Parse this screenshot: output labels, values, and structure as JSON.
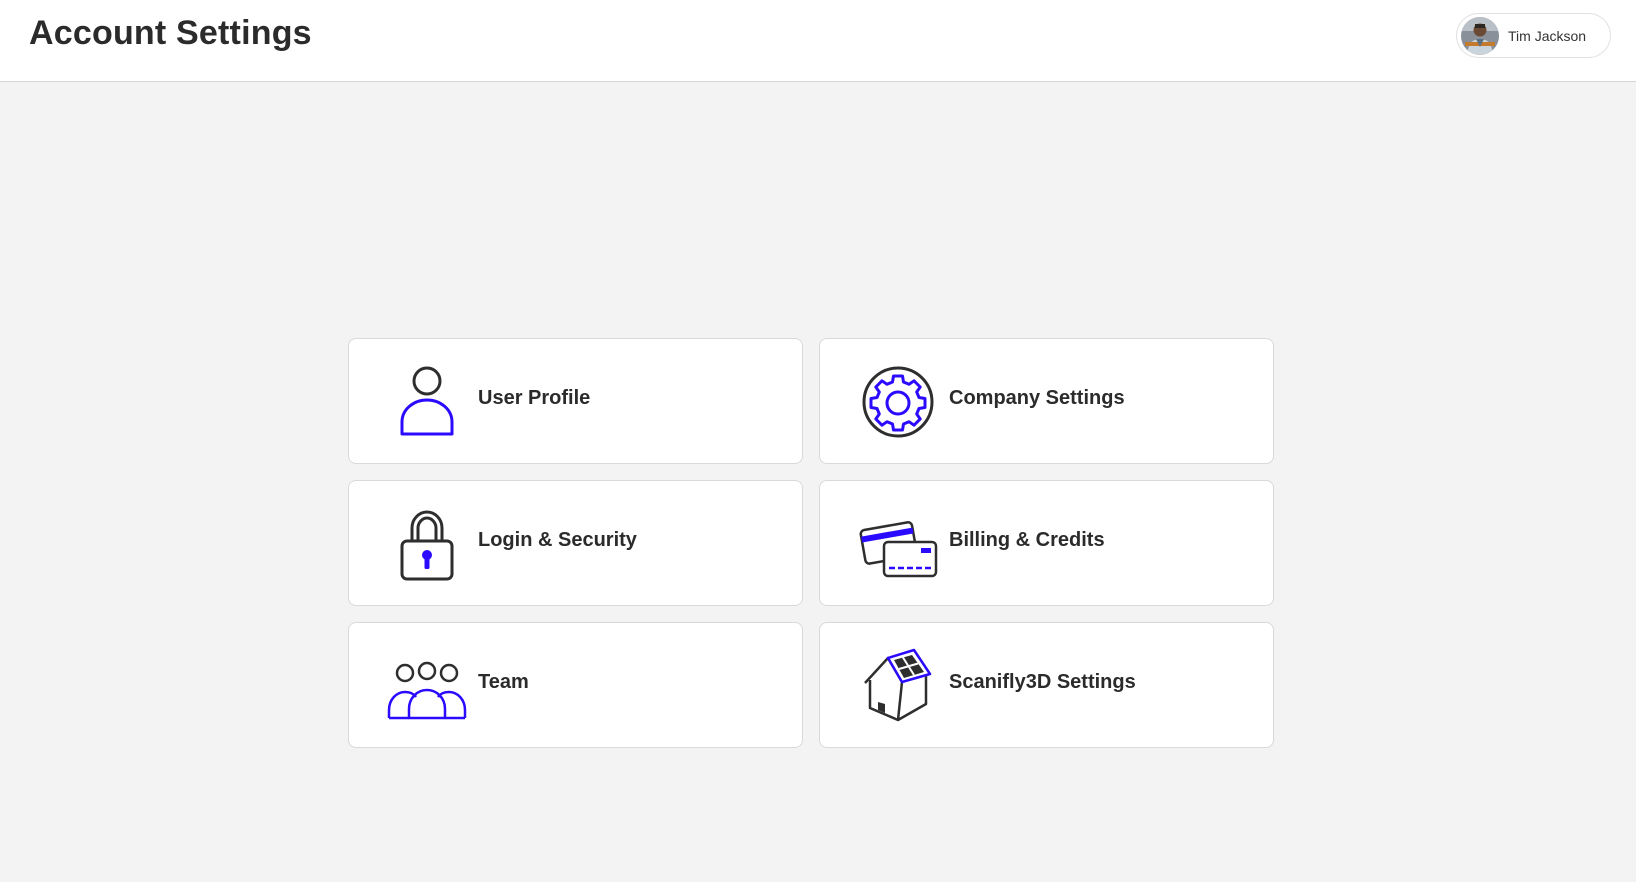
{
  "header": {
    "title": "Account Settings",
    "user": {
      "name": "Tim Jackson",
      "avatar_icon": "user-avatar-photo"
    }
  },
  "colors": {
    "accent": "#2b0bff",
    "stroke": "#2e2e2e",
    "background": "#f3f3f3"
  },
  "cards": [
    {
      "label": "User Profile",
      "icon": "user-profile-icon"
    },
    {
      "label": "Company Settings",
      "icon": "gear-icon"
    },
    {
      "label": "Login & Security",
      "icon": "lock-icon"
    },
    {
      "label": "Billing & Credits",
      "icon": "credit-cards-icon"
    },
    {
      "label": "Team",
      "icon": "team-icon"
    },
    {
      "label": "Scanifly3D Settings",
      "icon": "solar-house-icon"
    }
  ]
}
